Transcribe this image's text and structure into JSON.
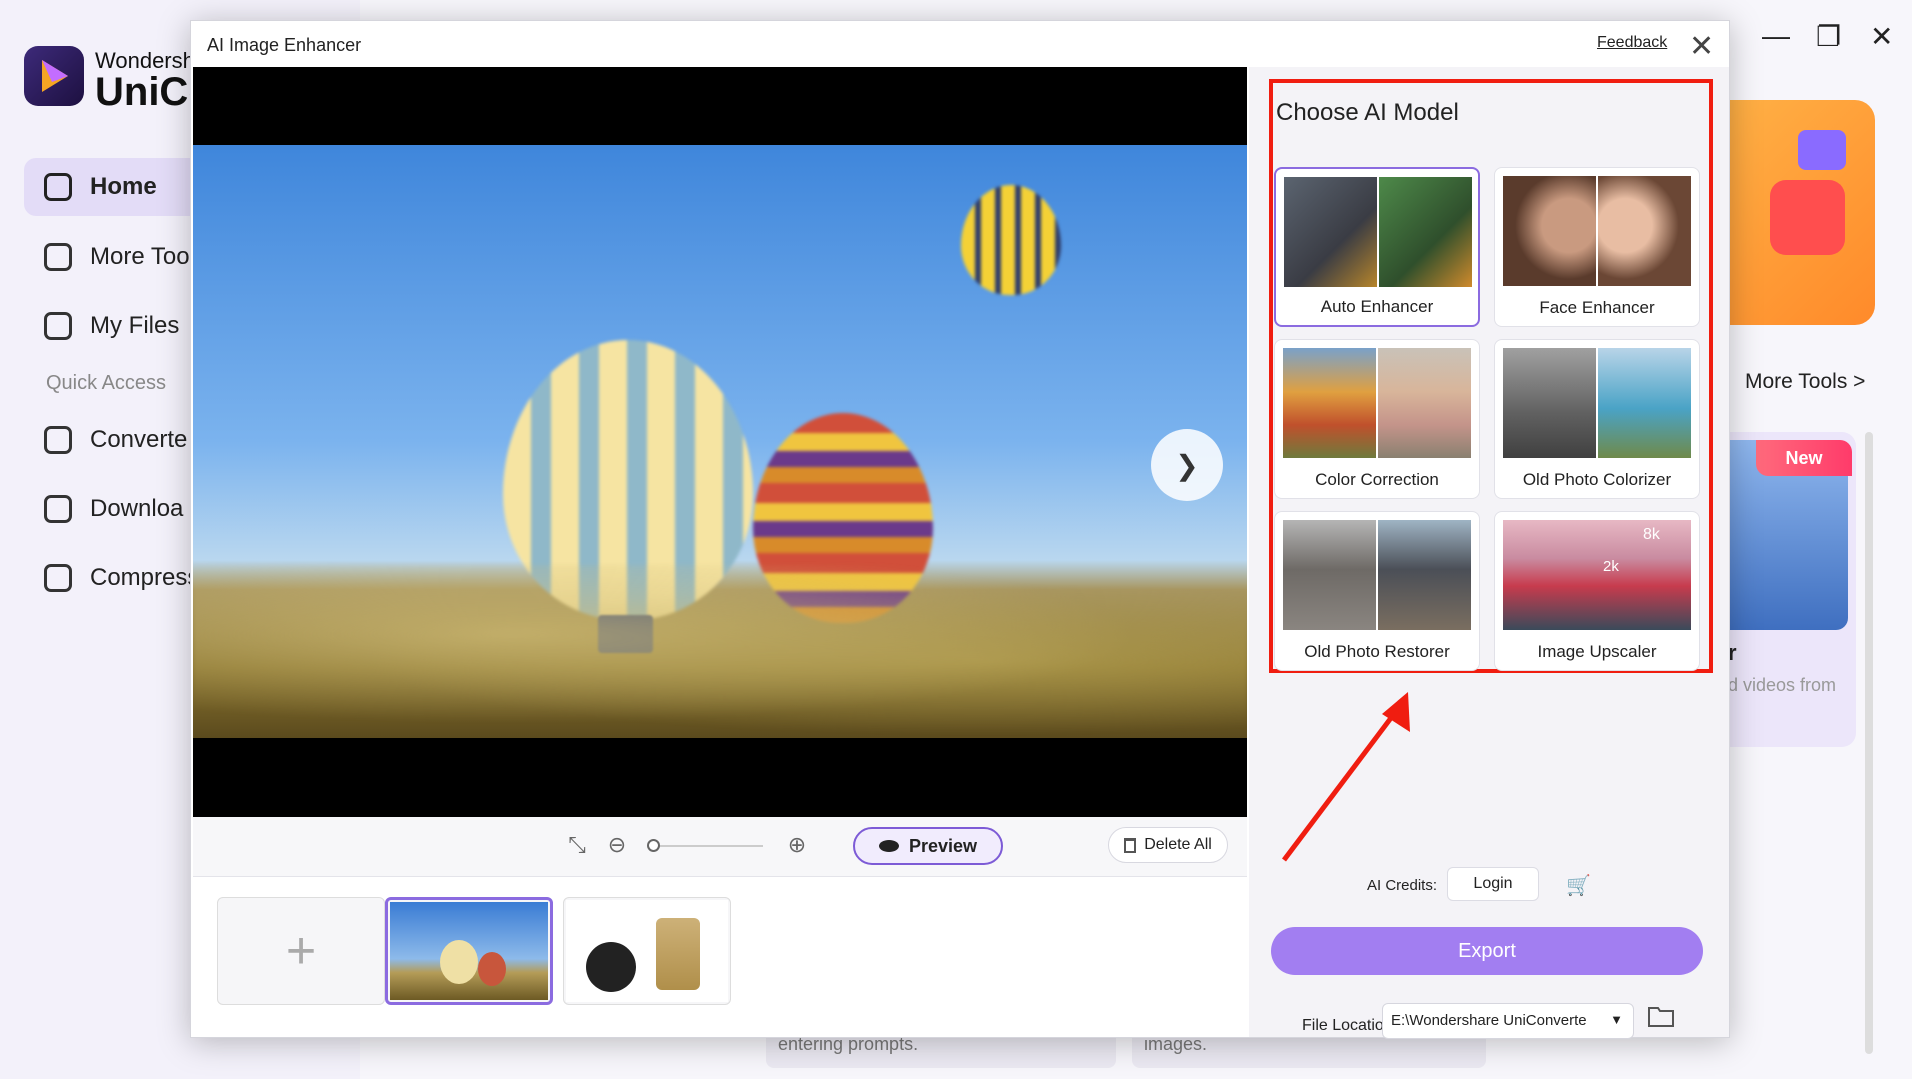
{
  "app": {
    "brand_line1": "Wondersh",
    "brand_line2": "UniCo",
    "nav": [
      {
        "label": "Home"
      },
      {
        "label": "More Too"
      },
      {
        "label": "My Files"
      }
    ],
    "quick_access_label": "Quick Access",
    "quick_items": [
      {
        "label": "Converte"
      },
      {
        "label": "Downloa"
      },
      {
        "label": "Compress"
      }
    ],
    "more_tools_link": "More Tools  >",
    "new_badge": "New",
    "tool_card_title": "r",
    "tool_card_desc": "d videos from",
    "bottom_card_texts": [
      "entering prompts.",
      "images."
    ]
  },
  "modal": {
    "title": "AI Image Enhancer",
    "feedback_label": "Feedback",
    "close_glyph": "✕",
    "toolbar": {
      "preview_label": "Preview",
      "delete_all_label": "Delete All",
      "zoom_level": 0
    },
    "thumbnails": [
      {
        "kind": "add",
        "glyph": "+"
      },
      {
        "kind": "balloons",
        "selected": true
      },
      {
        "kind": "products",
        "selected": false
      }
    ],
    "panel": {
      "title": "Choose AI Model",
      "models": [
        {
          "label": "Auto Enhancer",
          "selected": true
        },
        {
          "label": "Face Enhancer",
          "selected": false
        },
        {
          "label": "Color Correction",
          "selected": false
        },
        {
          "label": "Old Photo Colorizer",
          "selected": false
        },
        {
          "label": "Old Photo Restorer",
          "selected": false
        },
        {
          "label": "Image Upscaler",
          "selected": false
        }
      ],
      "upscale_marks": [
        "8k",
        "2k"
      ],
      "credits_label": "AI Credits:",
      "login_label": "Login",
      "export_label": "Export",
      "file_location_label": "File Location",
      "file_location_value": "E:\\Wondershare UniConverte"
    }
  },
  "colors": {
    "accent": "#8b6be0",
    "export_bg": "#a27ef1",
    "highlight_red": "#f01d10"
  }
}
